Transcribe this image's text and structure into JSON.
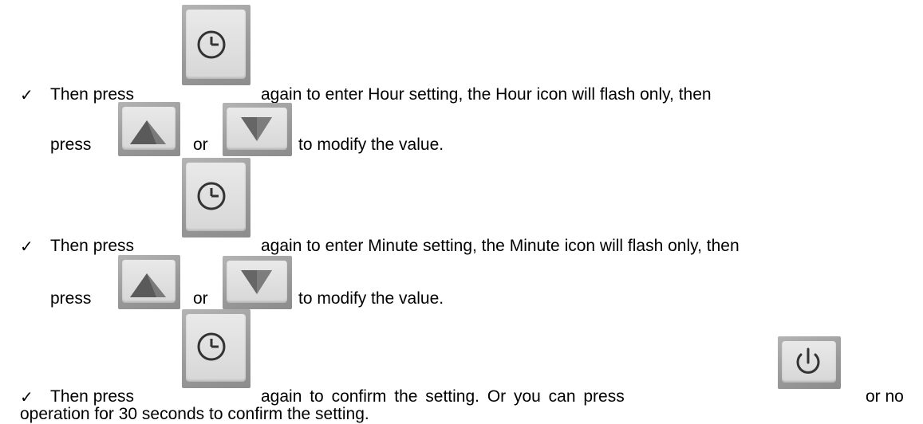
{
  "bullet": "✓",
  "item1": {
    "line1_a": "Then press",
    "line1_b": "again to enter Hour setting, the Hour icon will flash only, then",
    "line2_a": "press",
    "line2_or": "or",
    "line2_b": "to modify the value."
  },
  "item2": {
    "line1_a": "Then press",
    "line1_b": "again to enter Minute setting, the Minute icon will flash only, then",
    "line2_a": "press",
    "line2_or": "or",
    "line2_b": "to modify the value."
  },
  "item3": {
    "line1_a": "Then press",
    "line1_b": "again to confirm the setting. Or you can press",
    "line1_c": "or no",
    "line2": "operation for 30 seconds to confirm the setting."
  },
  "icons": {
    "clock": "clock-icon",
    "up": "up-arrow-icon",
    "down": "down-arrow-icon",
    "power": "power-icon"
  }
}
